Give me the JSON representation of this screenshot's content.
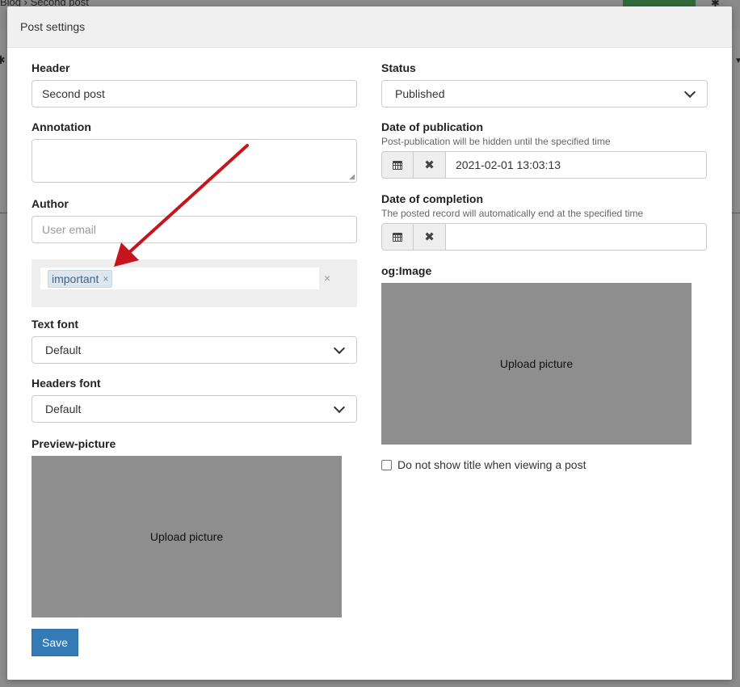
{
  "background": {
    "breadcrumb": "Blog  ›  Second post"
  },
  "modal": {
    "title": "Post settings"
  },
  "form": {
    "header": {
      "label": "Header",
      "value": "Second post"
    },
    "annotation": {
      "label": "Annotation",
      "value": ""
    },
    "author": {
      "label": "Author",
      "placeholder": "User email"
    },
    "tags": {
      "items": [
        "important"
      ],
      "remove_glyph": "×",
      "clear_glyph": "×"
    },
    "text_font": {
      "label": "Text font",
      "selected": "Default"
    },
    "headers_font": {
      "label": "Headers font",
      "selected": "Default"
    },
    "preview_picture": {
      "label": "Preview-picture",
      "upload_text": "Upload picture"
    },
    "status": {
      "label": "Status",
      "selected": "Published"
    },
    "date_publication": {
      "label": "Date of publication",
      "hint": "Post-publication will be hidden until the specified time",
      "value": "2021-02-01 13:03:13"
    },
    "date_completion": {
      "label": "Date of completion",
      "hint": "The posted record will automatically end at the specified time",
      "value": ""
    },
    "og_image": {
      "label": "og:Image",
      "upload_text": "Upload picture"
    },
    "hide_title": {
      "label": "Do not show title when viewing a post",
      "checked": false
    },
    "save_label": "Save"
  },
  "colors": {
    "primary_button": "#337ab7",
    "annotation_arrow": "#c4161c",
    "tag_bg": "#dbe6ef"
  },
  "icons": {
    "calendar": "calendar-icon",
    "clear": "times-icon",
    "select_caret": "chevron-down-icon"
  }
}
